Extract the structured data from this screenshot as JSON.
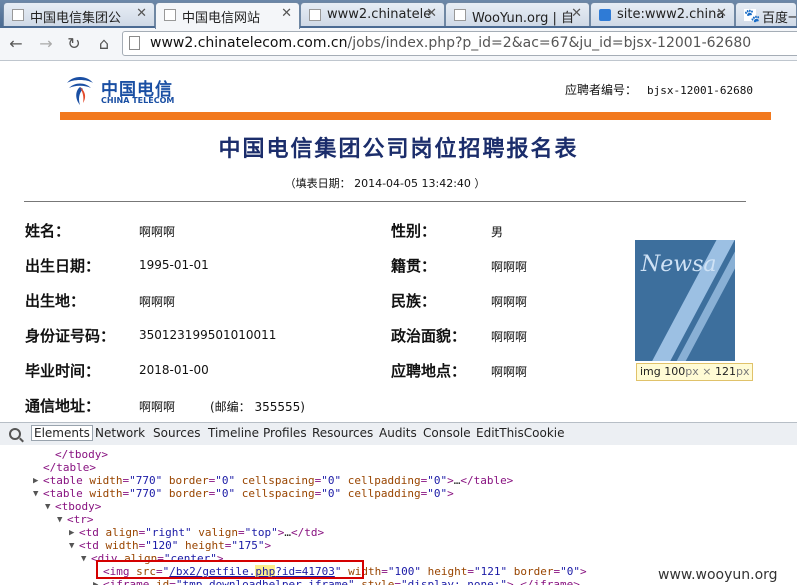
{
  "browser": {
    "tabs": [
      {
        "title": "中国电信集团公",
        "active": false
      },
      {
        "title": "中国电信网站",
        "active": true
      },
      {
        "title": "www2.chinatele",
        "active": false
      },
      {
        "title": "WooYun.org | 自",
        "active": false
      },
      {
        "title": "site:www2.china",
        "active": false
      },
      {
        "title": "百度一",
        "active": false
      }
    ],
    "url_domain": "www2.chinatelecom.com.cn",
    "url_path": "/jobs/index.php?p_id=2&ac=67&ju_id=bjsx-12001-62680"
  },
  "page": {
    "logo_cn": "中国电信",
    "logo_en": "CHINA TELECOM",
    "applicant_no_label": "应聘者编号：",
    "applicant_no": "bjsx-12001-62680",
    "title": "中国电信集团公司岗位招聘报名表",
    "fill_date": "（填表日期： 2014-04-05 13:42:40 ）",
    "fields": {
      "name_label": "姓名：",
      "name": "啊啊啊",
      "gender_label": "性别：",
      "gender": "男",
      "birth_label": "出生日期：",
      "birth": "1995-01-01",
      "native_label": "籍贯：",
      "native": "啊啊啊",
      "birthplace_label": "出生地：",
      "birthplace": "啊啊啊",
      "ethnic_label": "民族：",
      "ethnic": "啊啊啊",
      "id_label": "身份证号码：",
      "id": "350123199501010011",
      "political_label": "政治面貌：",
      "political": "啊啊啊",
      "grad_label": "毕业时间：",
      "grad": "2018-01-00",
      "location_label": "应聘地点：",
      "location": "啊啊啊",
      "address_label": "通信地址：",
      "address": "啊啊啊",
      "postcode": "(邮编： 355555)"
    },
    "photo_text": "Newsa",
    "tooltip_tag": "img",
    "tooltip_w": "100",
    "tooltip_px": "px",
    "tooltip_x": "×",
    "tooltip_h": "121",
    "tooltip_px2": "px"
  },
  "devtools": {
    "tabs": [
      "Elements",
      "Network",
      "Sources",
      "Timeline",
      "Profiles",
      "Resources",
      "Audits",
      "Console",
      "EditThisCookie"
    ],
    "selected_tab": "Elements"
  },
  "watermark": "www.wooyun.org"
}
